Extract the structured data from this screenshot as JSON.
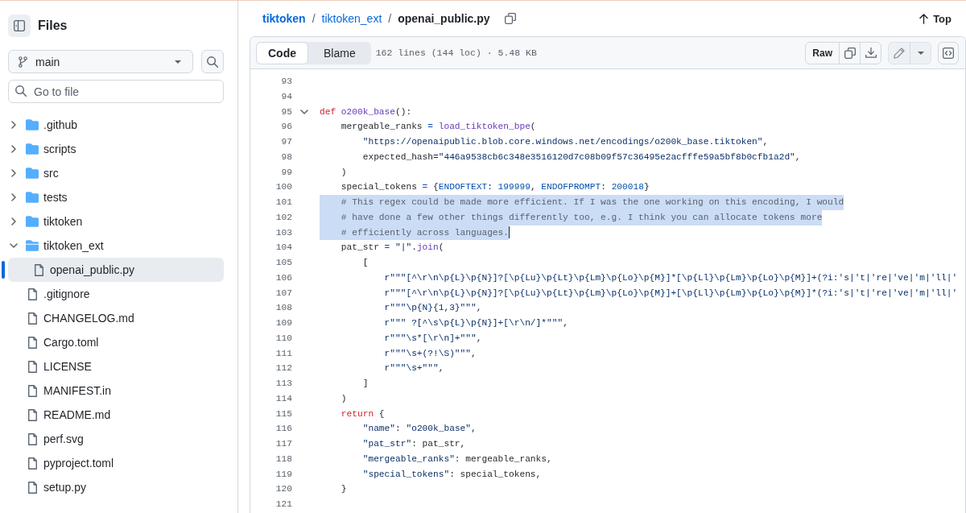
{
  "sidebar": {
    "title": "Files",
    "branch": "main",
    "search": {
      "placeholder": "Go to file"
    },
    "tree": [
      {
        "name": ".github",
        "kind": "folder",
        "expanded": false,
        "selected": false
      },
      {
        "name": "scripts",
        "kind": "folder",
        "expanded": false,
        "selected": false
      },
      {
        "name": "src",
        "kind": "folder",
        "expanded": false,
        "selected": false
      },
      {
        "name": "tests",
        "kind": "folder",
        "expanded": false,
        "selected": false
      },
      {
        "name": "tiktoken",
        "kind": "folder",
        "expanded": false,
        "selected": false
      },
      {
        "name": "tiktoken_ext",
        "kind": "folder",
        "expanded": true,
        "selected": false,
        "children": [
          {
            "name": "openai_public.py",
            "kind": "file",
            "selected": true
          }
        ]
      },
      {
        "name": ".gitignore",
        "kind": "file",
        "selected": false
      },
      {
        "name": "CHANGELOG.md",
        "kind": "file",
        "selected": false
      },
      {
        "name": "Cargo.toml",
        "kind": "file",
        "selected": false
      },
      {
        "name": "LICENSE",
        "kind": "file",
        "selected": false
      },
      {
        "name": "MANIFEST.in",
        "kind": "file",
        "selected": false
      },
      {
        "name": "README.md",
        "kind": "file",
        "selected": false
      },
      {
        "name": "perf.svg",
        "kind": "file",
        "selected": false
      },
      {
        "name": "pyproject.toml",
        "kind": "file",
        "selected": false
      },
      {
        "name": "setup.py",
        "kind": "file",
        "selected": false
      }
    ]
  },
  "breadcrumb": [
    {
      "label": "tiktoken",
      "kind": "repo"
    },
    {
      "label": "/",
      "kind": "separator"
    },
    {
      "label": "tiktoken_ext",
      "kind": "dir"
    },
    {
      "label": "/",
      "kind": "separator"
    },
    {
      "label": "openai_public.py",
      "kind": "file"
    }
  ],
  "top_link": {
    "label": "Top"
  },
  "toolbar": {
    "tabs": [
      {
        "label": "Code",
        "selected": true
      },
      {
        "label": "Blame",
        "selected": false
      }
    ],
    "file_info": "162 lines (144 loc) · 5.48 KB",
    "raw_button": {
      "label": "Raw"
    }
  },
  "code": {
    "lines": [
      {
        "number": "93",
        "selected": false,
        "cursor": false
      },
      {
        "number": "94",
        "selected": false,
        "cursor": false
      },
      {
        "number": "95",
        "fold": {
          "expanded": true
        },
        "tokens": [
          {
            "text": "def",
            "kind": "keyword"
          },
          {
            "text": " o200k_base",
            "kind": "function"
          },
          {
            "text": "():",
            "kind": "plain"
          }
        ],
        "selected": false,
        "cursor": false
      },
      {
        "number": "96",
        "tokens": [
          {
            "text": "    mergeable_ranks ",
            "kind": "plain"
          },
          {
            "text": "=",
            "kind": "operator"
          },
          {
            "text": " load_tiktoken_bpe",
            "kind": "function"
          },
          {
            "text": "(",
            "kind": "plain"
          }
        ],
        "selected": false,
        "cursor": false
      },
      {
        "number": "97",
        "tokens": [
          {
            "text": "        \"https://openaipublic.blob.core.windows.net/encodings/o200k_base.tiktoken\"",
            "kind": "string"
          },
          {
            "text": ",",
            "kind": "plain"
          }
        ],
        "selected": false,
        "cursor": false
      },
      {
        "number": "98",
        "tokens": [
          {
            "text": "        expected_hash=",
            "kind": "plain"
          },
          {
            "text": "\"446a9538cb6c348e3516120d7c08b09f57c36495e2acfffe59a5bf8b0cfb1a2d\"",
            "kind": "string"
          },
          {
            "text": ",",
            "kind": "plain"
          }
        ],
        "selected": false,
        "cursor": false
      },
      {
        "number": "99",
        "tokens": [
          {
            "text": "    )",
            "kind": "plain"
          }
        ],
        "selected": false,
        "cursor": false
      },
      {
        "number": "100",
        "tokens": [
          {
            "text": "    special_tokens ",
            "kind": "plain"
          },
          {
            "text": "=",
            "kind": "operator"
          },
          {
            "text": " {",
            "kind": "plain"
          },
          {
            "text": "ENDOFTEXT",
            "kind": "constant"
          },
          {
            "text": ": ",
            "kind": "plain"
          },
          {
            "text": "199999",
            "kind": "constant"
          },
          {
            "text": ", ",
            "kind": "plain"
          },
          {
            "text": "ENDOFPROMPT",
            "kind": "constant"
          },
          {
            "text": ": ",
            "kind": "plain"
          },
          {
            "text": "200018",
            "kind": "constant"
          },
          {
            "text": "}",
            "kind": "plain"
          }
        ],
        "selected": false,
        "cursor": false
      },
      {
        "number": "101",
        "tokens": [
          {
            "text": "    # This regex could be made more efficient. If I was the one working on this encoding, I would",
            "kind": "comment"
          }
        ],
        "selected": true,
        "cursor": false
      },
      {
        "number": "102",
        "tokens": [
          {
            "text": "    # have done a few other things differently too, e.g. I think you can allocate tokens more",
            "kind": "comment"
          }
        ],
        "selected": true,
        "cursor": false
      },
      {
        "number": "103",
        "tokens": [
          {
            "text": "    # efficiently across languages.",
            "kind": "comment"
          }
        ],
        "selected": true,
        "cursor": true
      },
      {
        "number": "104",
        "tokens": [
          {
            "text": "    pat_str ",
            "kind": "plain"
          },
          {
            "text": "=",
            "kind": "operator"
          },
          {
            "text": " \"|\"",
            "kind": "string"
          },
          {
            "text": ".",
            "kind": "plain"
          },
          {
            "text": "join",
            "kind": "function"
          },
          {
            "text": "(",
            "kind": "plain"
          }
        ],
        "selected": false,
        "cursor": false
      },
      {
        "number": "105",
        "tokens": [
          {
            "text": "        [",
            "kind": "plain"
          }
        ],
        "selected": false,
        "cursor": false
      },
      {
        "number": "106",
        "tokens": [
          {
            "text": "            r\"\"\"[^\\r\\n\\p{L}\\p{N}]?[\\p{Lu}\\p{Lt}\\p{Lm}\\p{Lo}\\p{M}]*[\\p{Ll}\\p{Lm}\\p{Lo}\\p{M}]+(?i:'s|'t|'re|'ve|'m|'ll|'",
            "kind": "string"
          }
        ],
        "selected": false,
        "cursor": false
      },
      {
        "number": "107",
        "tokens": [
          {
            "text": "            r\"\"\"[^\\r\\n\\p{L}\\p{N}]?[\\p{Lu}\\p{Lt}\\p{Lm}\\p{Lo}\\p{M}]+[\\p{Ll}\\p{Lm}\\p{Lo}\\p{M}]*(?i:'s|'t|'re|'ve|'m|'ll|'",
            "kind": "string"
          }
        ],
        "selected": false,
        "cursor": false
      },
      {
        "number": "108",
        "tokens": [
          {
            "text": "            r\"\"\"\\p{N}{1,3}\"\"\"",
            "kind": "string"
          },
          {
            "text": ",",
            "kind": "plain"
          }
        ],
        "selected": false,
        "cursor": false
      },
      {
        "number": "109",
        "tokens": [
          {
            "text": "            r\"\"\" ?[^\\s\\p{L}\\p{N}]+[\\r\\n/]*\"\"\"",
            "kind": "string"
          },
          {
            "text": ",",
            "kind": "plain"
          }
        ],
        "selected": false,
        "cursor": false
      },
      {
        "number": "110",
        "tokens": [
          {
            "text": "            r\"\"\"\\s*[\\r\\n]+\"\"\"",
            "kind": "string"
          },
          {
            "text": ",",
            "kind": "plain"
          }
        ],
        "selected": false,
        "cursor": false
      },
      {
        "number": "111",
        "tokens": [
          {
            "text": "            r\"\"\"\\s+(?!\\S)\"\"\"",
            "kind": "string"
          },
          {
            "text": ",",
            "kind": "plain"
          }
        ],
        "selected": false,
        "cursor": false
      },
      {
        "number": "112",
        "tokens": [
          {
            "text": "            r\"\"\"\\s+\"\"\"",
            "kind": "string"
          },
          {
            "text": ",",
            "kind": "plain"
          }
        ],
        "selected": false,
        "cursor": false
      },
      {
        "number": "113",
        "tokens": [
          {
            "text": "        ]",
            "kind": "plain"
          }
        ],
        "selected": false,
        "cursor": false
      },
      {
        "number": "114",
        "tokens": [
          {
            "text": "    )",
            "kind": "plain"
          }
        ],
        "selected": false,
        "cursor": false
      },
      {
        "number": "115",
        "tokens": [
          {
            "text": "    return",
            "kind": "keyword"
          },
          {
            "text": " {",
            "kind": "plain"
          }
        ],
        "selected": false,
        "cursor": false
      },
      {
        "number": "116",
        "tokens": [
          {
            "text": "        \"name\"",
            "kind": "string"
          },
          {
            "text": ": ",
            "kind": "plain"
          },
          {
            "text": "\"o200k_base\"",
            "kind": "string"
          },
          {
            "text": ",",
            "kind": "plain"
          }
        ],
        "selected": false,
        "cursor": false
      },
      {
        "number": "117",
        "tokens": [
          {
            "text": "        \"pat_str\"",
            "kind": "string"
          },
          {
            "text": ": pat_str,",
            "kind": "plain"
          }
        ],
        "selected": false,
        "cursor": false
      },
      {
        "number": "118",
        "tokens": [
          {
            "text": "        \"mergeable_ranks\"",
            "kind": "string"
          },
          {
            "text": ": mergeable_ranks,",
            "kind": "plain"
          }
        ],
        "selected": false,
        "cursor": false
      },
      {
        "number": "119",
        "tokens": [
          {
            "text": "        \"special_tokens\"",
            "kind": "string"
          },
          {
            "text": ": special_tokens,",
            "kind": "plain"
          }
        ],
        "selected": false,
        "cursor": false
      },
      {
        "number": "120",
        "tokens": [
          {
            "text": "    }",
            "kind": "plain"
          }
        ],
        "selected": false,
        "cursor": false
      },
      {
        "number": "121",
        "selected": false,
        "cursor": false
      }
    ]
  }
}
